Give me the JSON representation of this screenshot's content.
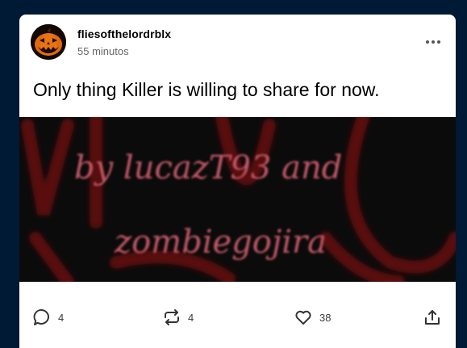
{
  "post": {
    "username": "fliesofthelordrblx",
    "timestamp": "55 minutos",
    "text": "Only thing Killer is willing to share for now.",
    "image_text": {
      "line1": "by lucazT93 and",
      "line2": "zombiegojira"
    }
  },
  "actions": {
    "replies": "4",
    "reblogs": "4",
    "likes": "38"
  },
  "icons": {
    "avatar": "jack-o-lantern-avatar",
    "more": "more-dots-icon",
    "reply": "speech-bubble-icon",
    "reblog": "reblog-icon",
    "like": "heart-icon",
    "share": "share-icon"
  },
  "colors": {
    "page_bg": "#001935",
    "card_bg": "#ffffff",
    "image_text": "#c25766",
    "image_bg_marks": "#5a0a0e"
  }
}
